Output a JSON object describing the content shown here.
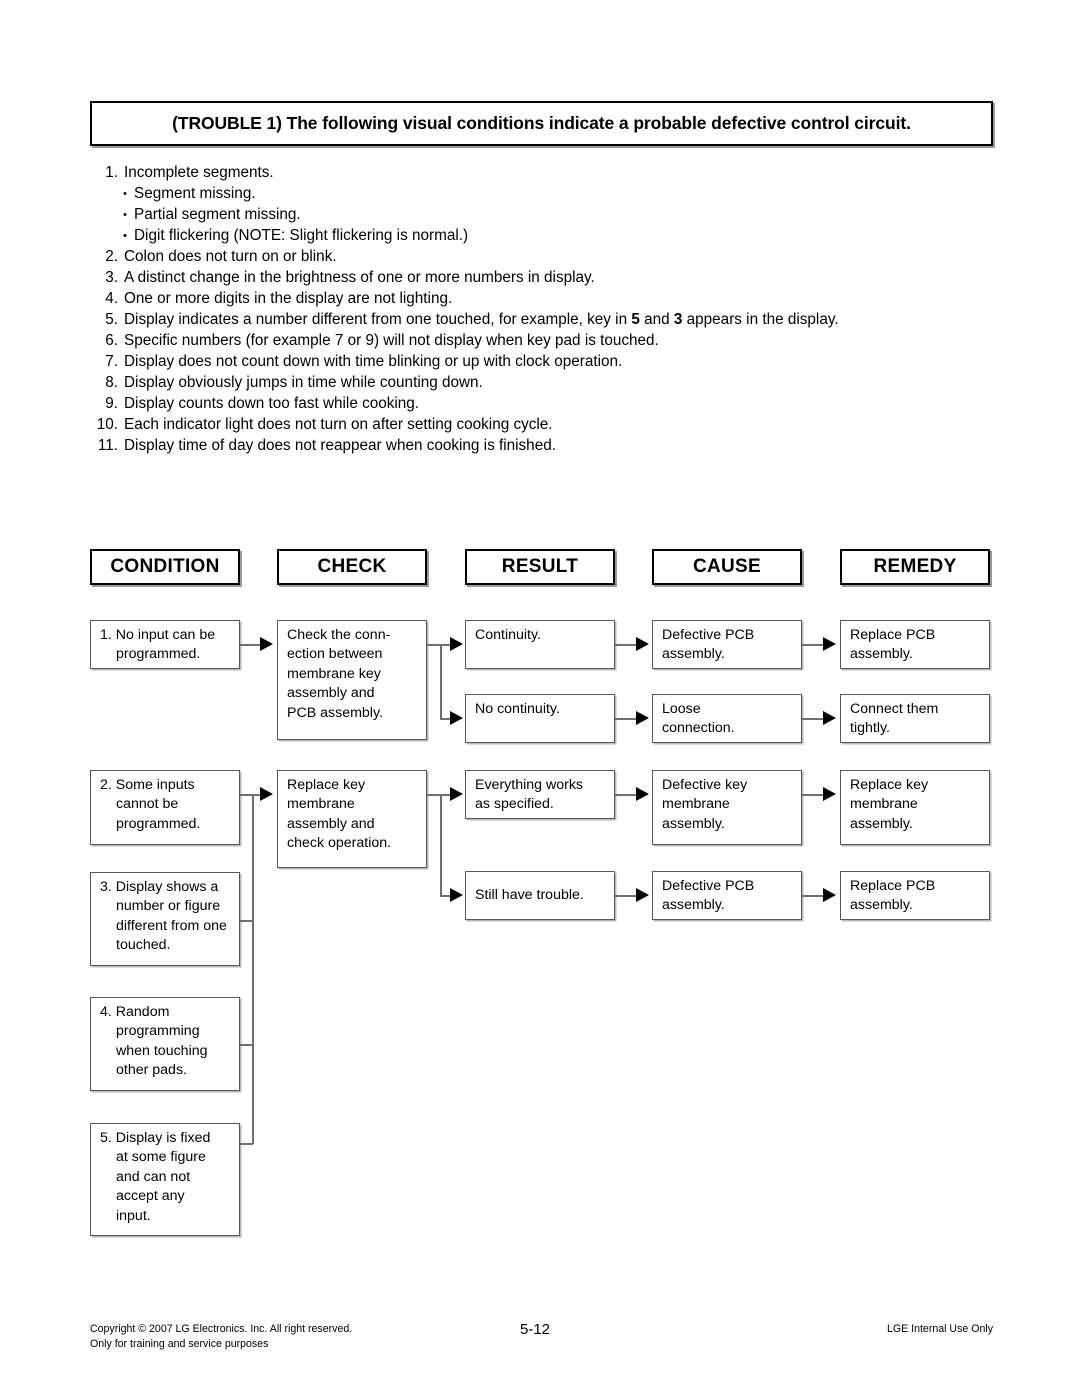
{
  "banner": {
    "title": "(TROUBLE 1) The following visual conditions indicate a probable defective control circuit."
  },
  "conditions_list": [
    {
      "num": "1.",
      "text": "Incomplete segments.",
      "subitems": [
        "Segment missing.",
        "Partial segment missing.",
        "Digit flickering (NOTE: Slight flickering is normal.)"
      ]
    },
    {
      "num": "2.",
      "text": "Colon does not turn on or blink.",
      "subitems": []
    },
    {
      "num": "3.",
      "text": "A distinct change in the brightness of one or more numbers in display.",
      "subitems": []
    },
    {
      "num": "4.",
      "text": "One or more digits in the display are not lighting.",
      "subitems": []
    },
    {
      "num": "5.",
      "text": "Display indicates a number different from one touched, for example, key in 5 and 3 appears in the display.",
      "html_parts": {
        "pre": "Display indicates a number different from one touched, for example, key in ",
        "bold1": "5",
        "mid": " and ",
        "bold2": "3",
        "post": " appears in the display."
      },
      "subitems": []
    },
    {
      "num": "6.",
      "text": "Specific numbers (for example 7 or 9) will not display when key pad is touched.",
      "subitems": []
    },
    {
      "num": "7.",
      "text": "Display does not count down with time blinking or up with clock operation.",
      "subitems": []
    },
    {
      "num": "8.",
      "text": "Display obviously jumps in time while counting down.",
      "subitems": []
    },
    {
      "num": "9.",
      "text": "Display counts down too fast while cooking.",
      "subitems": []
    },
    {
      "num": "10.",
      "text": "Each indicator light does not turn on after setting cooking cycle.",
      "subitems": []
    },
    {
      "num": "11.",
      "text": "Display time of day does not reappear when cooking is finished.",
      "subitems": []
    }
  ],
  "bullet_glyph": "•",
  "flow": {
    "headers": [
      {
        "label": "CONDITION"
      },
      {
        "label": "CHECK"
      },
      {
        "label": "RESULT"
      },
      {
        "label": "CAUSE"
      },
      {
        "label": "REMEDY"
      }
    ],
    "conditions": [
      {
        "line1": "1. No input can be",
        "line2": "programmed."
      },
      {
        "line1": "2. Some inputs",
        "line2": "cannot be",
        "line3": "programmed."
      },
      {
        "line1": "3. Display shows a",
        "line2": "number or figure",
        "line3": "different from one",
        "line4": "touched."
      },
      {
        "line1": "4. Random",
        "line2": "programming",
        "line3": "when touching",
        "line4": "other pads."
      },
      {
        "line1": "5. Display is fixed",
        "line2": "at some figure",
        "line3": "and can not",
        "line4": "accept any",
        "line5": "input."
      }
    ],
    "checks": [
      {
        "line1": "Check the conn-",
        "line2": "ection between",
        "line3": "membrane key",
        "line4": "assembly and",
        "line5": "PCB assembly."
      },
      {
        "line1": "Replace key",
        "line2": "membrane",
        "line3": "assembly and",
        "line4": "check operation."
      }
    ],
    "results": [
      {
        "line1": "Continuity."
      },
      {
        "line1": "No continuity."
      },
      {
        "line1": "Everything works",
        "line2": "as specified."
      },
      {
        "line1": "Still have trouble."
      }
    ],
    "causes": [
      {
        "line1": "Defective PCB",
        "line2": "assembly."
      },
      {
        "line1": "Loose",
        "line2": "connection."
      },
      {
        "line1": "Defective key",
        "line2": "membrane",
        "line3": "assembly."
      },
      {
        "line1": "Defective PCB",
        "line2": "assembly."
      }
    ],
    "remedies": [
      {
        "line1": "Replace PCB",
        "line2": "assembly."
      },
      {
        "line1": "Connect them",
        "line2": "tightly."
      },
      {
        "line1": "Replace key",
        "line2": "membrane",
        "line3": "assembly."
      },
      {
        "line1": "Replace PCB",
        "line2": "assembly."
      }
    ]
  },
  "footer": {
    "copyright_line1": "Copyright © 2007 LG Electronics. Inc. All right reserved.",
    "copyright_line2": "Only for training and service purposes",
    "page_number": "5-12",
    "notice": "LGE Internal Use Only"
  }
}
